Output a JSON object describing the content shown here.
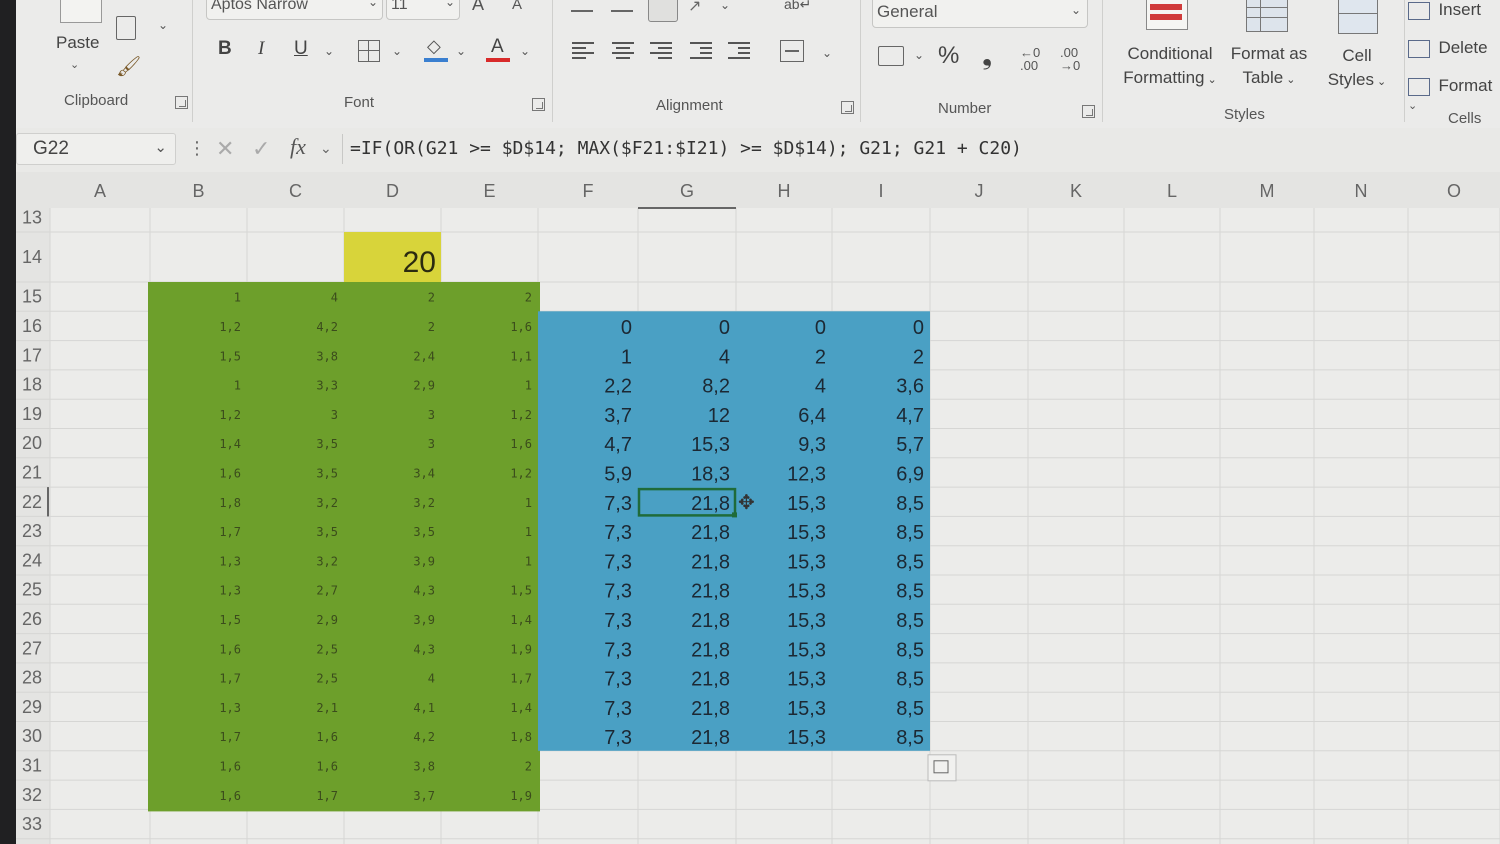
{
  "ribbon": {
    "font_name": "Aptos Narrow",
    "font_size": "11",
    "number_format": "General",
    "paste_label": "Paste",
    "groups": {
      "clipboard": "Clipboard",
      "font": "Font",
      "alignment": "Alignment",
      "number": "Number",
      "styles": "Styles",
      "cells": "Cells"
    },
    "styles_buttons": {
      "conditional_1": "Conditional",
      "conditional_2": "Formatting",
      "format_table_1": "Format as",
      "format_table_2": "Table",
      "cell_styles_1": "Cell",
      "cell_styles_2": "Styles"
    },
    "cells_buttons": {
      "insert": "Insert",
      "delete": "Delete",
      "format": "Format"
    },
    "font_buttons": {
      "bold": "B",
      "italic": "I",
      "underline": "U",
      "grow": "A",
      "shrink": "A",
      "font_color": "A"
    },
    "number_buttons": {
      "percent": "%",
      "comma": "❟",
      "inc_dec": ".00",
      "dec_dec": ".00"
    }
  },
  "formula_bar": {
    "name_box": "G22",
    "fx": "fx",
    "formula": "=IF(OR(G21 >= $D$14; MAX($F21:$I21) >= $D$14); G21; G21 + C20)"
  },
  "columns": [
    "A",
    "B",
    "C",
    "D",
    "E",
    "F",
    "G",
    "H",
    "I",
    "J",
    "K",
    "L",
    "M",
    "N",
    "O"
  ],
  "rows": [
    "13",
    "14",
    "15",
    "16",
    "17",
    "18",
    "19",
    "20",
    "21",
    "22",
    "23",
    "24",
    "25",
    "26",
    "27",
    "28",
    "29",
    "30",
    "31",
    "32",
    "33"
  ],
  "threshold_cell": {
    "ref": "D14",
    "value": "20",
    "color": "#d8d43a"
  },
  "colors": {
    "green_block": "#6d9f2b",
    "blue_block": "#4aa0c4",
    "selection": "#1f6b3a"
  },
  "green_rows": [
    [
      "1",
      "4",
      "2",
      "2"
    ],
    [
      "1,2",
      "4,2",
      "2",
      "1,6"
    ],
    [
      "1,5",
      "3,8",
      "2,4",
      "1,1"
    ],
    [
      "1",
      "3,3",
      "2,9",
      "1"
    ],
    [
      "1,2",
      "3",
      "3",
      "1,2"
    ],
    [
      "1,4",
      "3,5",
      "3",
      "1,6"
    ],
    [
      "1,6",
      "3,5",
      "3,4",
      "1,2"
    ],
    [
      "1,8",
      "3,2",
      "3,2",
      "1"
    ],
    [
      "1,7",
      "3,5",
      "3,5",
      "1"
    ],
    [
      "1,3",
      "3,2",
      "3,9",
      "1"
    ],
    [
      "1,3",
      "2,7",
      "4,3",
      "1,5"
    ],
    [
      "1,5",
      "2,9",
      "3,9",
      "1,4"
    ],
    [
      "1,6",
      "2,5",
      "4,3",
      "1,9"
    ],
    [
      "1,7",
      "2,5",
      "4",
      "1,7"
    ],
    [
      "1,3",
      "2,1",
      "4,1",
      "1,4"
    ],
    [
      "1,7",
      "1,6",
      "4,2",
      "1,8"
    ],
    [
      "1,6",
      "1,6",
      "3,8",
      "2"
    ],
    [
      "1,6",
      "1,7",
      "3,7",
      "1,9"
    ]
  ],
  "blue_rows": [
    [
      "0",
      "0",
      "0",
      "0"
    ],
    [
      "1",
      "4",
      "2",
      "2"
    ],
    [
      "2,2",
      "8,2",
      "4",
      "3,6"
    ],
    [
      "3,7",
      "12",
      "6,4",
      "4,7"
    ],
    [
      "4,7",
      "15,3",
      "9,3",
      "5,7"
    ],
    [
      "5,9",
      "18,3",
      "12,3",
      "6,9"
    ],
    [
      "7,3",
      "21,8",
      "15,3",
      "8,5"
    ],
    [
      "7,3",
      "21,8",
      "15,3",
      "8,5"
    ],
    [
      "7,3",
      "21,8",
      "15,3",
      "8,5"
    ],
    [
      "7,3",
      "21,8",
      "15,3",
      "8,5"
    ],
    [
      "7,3",
      "21,8",
      "15,3",
      "8,5"
    ],
    [
      "7,3",
      "21,8",
      "15,3",
      "8,5"
    ],
    [
      "7,3",
      "21,8",
      "15,3",
      "8,5"
    ],
    [
      "7,3",
      "21,8",
      "15,3",
      "8,5"
    ],
    [
      "7,3",
      "21,8",
      "15,3",
      "8,5"
    ]
  ],
  "selected_cell": "G22"
}
